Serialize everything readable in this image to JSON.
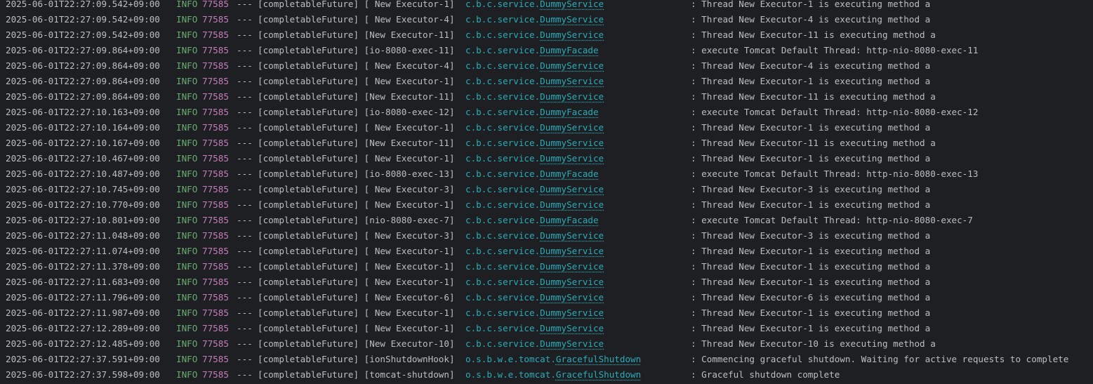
{
  "colors": {
    "background": "#1e1f22",
    "text": "#bcbec4",
    "level": "#6aab73",
    "pid": "#c77dbb",
    "logger": "#2aacb8"
  },
  "log_lines": [
    {
      "timestamp": "2025-06-01T22:27:09.542+09:00",
      "level": "INFO",
      "pid": "77585",
      "sep": "---",
      "app": "[completableFuture]",
      "thread": "[ New Executor-1]",
      "logger_pkg": "c.b.c.service.",
      "logger_cls": "DummyService",
      "message": ": Thread New Executor-1 is executing method a"
    },
    {
      "timestamp": "2025-06-01T22:27:09.542+09:00",
      "level": "INFO",
      "pid": "77585",
      "sep": "---",
      "app": "[completableFuture]",
      "thread": "[ New Executor-4]",
      "logger_pkg": "c.b.c.service.",
      "logger_cls": "DummyService",
      "message": ": Thread New Executor-4 is executing method a"
    },
    {
      "timestamp": "2025-06-01T22:27:09.542+09:00",
      "level": "INFO",
      "pid": "77585",
      "sep": "---",
      "app": "[completableFuture]",
      "thread": "[New Executor-11]",
      "logger_pkg": "c.b.c.service.",
      "logger_cls": "DummyService",
      "message": ": Thread New Executor-11 is executing method a"
    },
    {
      "timestamp": "2025-06-01T22:27:09.864+09:00",
      "level": "INFO",
      "pid": "77585",
      "sep": "---",
      "app": "[completableFuture]",
      "thread": "[io-8080-exec-11]",
      "logger_pkg": "c.b.c.service.",
      "logger_cls": "DummyFacade",
      "message": ": execute Tomcat Default Thread: http-nio-8080-exec-11"
    },
    {
      "timestamp": "2025-06-01T22:27:09.864+09:00",
      "level": "INFO",
      "pid": "77585",
      "sep": "---",
      "app": "[completableFuture]",
      "thread": "[ New Executor-4]",
      "logger_pkg": "c.b.c.service.",
      "logger_cls": "DummyService",
      "message": ": Thread New Executor-4 is executing method a"
    },
    {
      "timestamp": "2025-06-01T22:27:09.864+09:00",
      "level": "INFO",
      "pid": "77585",
      "sep": "---",
      "app": "[completableFuture]",
      "thread": "[ New Executor-1]",
      "logger_pkg": "c.b.c.service.",
      "logger_cls": "DummyService",
      "message": ": Thread New Executor-1 is executing method a"
    },
    {
      "timestamp": "2025-06-01T22:27:09.864+09:00",
      "level": "INFO",
      "pid": "77585",
      "sep": "---",
      "app": "[completableFuture]",
      "thread": "[New Executor-11]",
      "logger_pkg": "c.b.c.service.",
      "logger_cls": "DummyService",
      "message": ": Thread New Executor-11 is executing method a"
    },
    {
      "timestamp": "2025-06-01T22:27:10.163+09:00",
      "level": "INFO",
      "pid": "77585",
      "sep": "---",
      "app": "[completableFuture]",
      "thread": "[io-8080-exec-12]",
      "logger_pkg": "c.b.c.service.",
      "logger_cls": "DummyFacade",
      "message": ": execute Tomcat Default Thread: http-nio-8080-exec-12"
    },
    {
      "timestamp": "2025-06-01T22:27:10.164+09:00",
      "level": "INFO",
      "pid": "77585",
      "sep": "---",
      "app": "[completableFuture]",
      "thread": "[ New Executor-1]",
      "logger_pkg": "c.b.c.service.",
      "logger_cls": "DummyService",
      "message": ": Thread New Executor-1 is executing method a"
    },
    {
      "timestamp": "2025-06-01T22:27:10.167+09:00",
      "level": "INFO",
      "pid": "77585",
      "sep": "---",
      "app": "[completableFuture]",
      "thread": "[New Executor-11]",
      "logger_pkg": "c.b.c.service.",
      "logger_cls": "DummyService",
      "message": ": Thread New Executor-11 is executing method a"
    },
    {
      "timestamp": "2025-06-01T22:27:10.467+09:00",
      "level": "INFO",
      "pid": "77585",
      "sep": "---",
      "app": "[completableFuture]",
      "thread": "[ New Executor-1]",
      "logger_pkg": "c.b.c.service.",
      "logger_cls": "DummyService",
      "message": ": Thread New Executor-1 is executing method a"
    },
    {
      "timestamp": "2025-06-01T22:27:10.487+09:00",
      "level": "INFO",
      "pid": "77585",
      "sep": "---",
      "app": "[completableFuture]",
      "thread": "[io-8080-exec-13]",
      "logger_pkg": "c.b.c.service.",
      "logger_cls": "DummyFacade",
      "message": ": execute Tomcat Default Thread: http-nio-8080-exec-13"
    },
    {
      "timestamp": "2025-06-01T22:27:10.745+09:00",
      "level": "INFO",
      "pid": "77585",
      "sep": "---",
      "app": "[completableFuture]",
      "thread": "[ New Executor-3]",
      "logger_pkg": "c.b.c.service.",
      "logger_cls": "DummyService",
      "message": ": Thread New Executor-3 is executing method a"
    },
    {
      "timestamp": "2025-06-01T22:27:10.770+09:00",
      "level": "INFO",
      "pid": "77585",
      "sep": "---",
      "app": "[completableFuture]",
      "thread": "[ New Executor-1]",
      "logger_pkg": "c.b.c.service.",
      "logger_cls": "DummyService",
      "message": ": Thread New Executor-1 is executing method a"
    },
    {
      "timestamp": "2025-06-01T22:27:10.801+09:00",
      "level": "INFO",
      "pid": "77585",
      "sep": "---",
      "app": "[completableFuture]",
      "thread": "[nio-8080-exec-7]",
      "logger_pkg": "c.b.c.service.",
      "logger_cls": "DummyFacade",
      "message": ": execute Tomcat Default Thread: http-nio-8080-exec-7"
    },
    {
      "timestamp": "2025-06-01T22:27:11.048+09:00",
      "level": "INFO",
      "pid": "77585",
      "sep": "---",
      "app": "[completableFuture]",
      "thread": "[ New Executor-3]",
      "logger_pkg": "c.b.c.service.",
      "logger_cls": "DummyService",
      "message": ": Thread New Executor-3 is executing method a"
    },
    {
      "timestamp": "2025-06-01T22:27:11.074+09:00",
      "level": "INFO",
      "pid": "77585",
      "sep": "---",
      "app": "[completableFuture]",
      "thread": "[ New Executor-1]",
      "logger_pkg": "c.b.c.service.",
      "logger_cls": "DummyService",
      "message": ": Thread New Executor-1 is executing method a"
    },
    {
      "timestamp": "2025-06-01T22:27:11.378+09:00",
      "level": "INFO",
      "pid": "77585",
      "sep": "---",
      "app": "[completableFuture]",
      "thread": "[ New Executor-1]",
      "logger_pkg": "c.b.c.service.",
      "logger_cls": "DummyService",
      "message": ": Thread New Executor-1 is executing method a"
    },
    {
      "timestamp": "2025-06-01T22:27:11.683+09:00",
      "level": "INFO",
      "pid": "77585",
      "sep": "---",
      "app": "[completableFuture]",
      "thread": "[ New Executor-1]",
      "logger_pkg": "c.b.c.service.",
      "logger_cls": "DummyService",
      "message": ": Thread New Executor-1 is executing method a"
    },
    {
      "timestamp": "2025-06-01T22:27:11.796+09:00",
      "level": "INFO",
      "pid": "77585",
      "sep": "---",
      "app": "[completableFuture]",
      "thread": "[ New Executor-6]",
      "logger_pkg": "c.b.c.service.",
      "logger_cls": "DummyService",
      "message": ": Thread New Executor-6 is executing method a"
    },
    {
      "timestamp": "2025-06-01T22:27:11.987+09:00",
      "level": "INFO",
      "pid": "77585",
      "sep": "---",
      "app": "[completableFuture]",
      "thread": "[ New Executor-1]",
      "logger_pkg": "c.b.c.service.",
      "logger_cls": "DummyService",
      "message": ": Thread New Executor-1 is executing method a"
    },
    {
      "timestamp": "2025-06-01T22:27:12.289+09:00",
      "level": "INFO",
      "pid": "77585",
      "sep": "---",
      "app": "[completableFuture]",
      "thread": "[ New Executor-1]",
      "logger_pkg": "c.b.c.service.",
      "logger_cls": "DummyService",
      "message": ": Thread New Executor-1 is executing method a"
    },
    {
      "timestamp": "2025-06-01T22:27:12.485+09:00",
      "level": "INFO",
      "pid": "77585",
      "sep": "---",
      "app": "[completableFuture]",
      "thread": "[New Executor-10]",
      "logger_pkg": "c.b.c.service.",
      "logger_cls": "DummyService",
      "message": ": Thread New Executor-10 is executing method a"
    },
    {
      "timestamp": "2025-06-01T22:27:37.591+09:00",
      "level": "INFO",
      "pid": "77585",
      "sep": "---",
      "app": "[completableFuture]",
      "thread": "[ionShutdownHook]",
      "logger_pkg": "o.s.b.w.e.tomcat.",
      "logger_cls": "GracefulShutdown",
      "message": ": Commencing graceful shutdown. Waiting for active requests to complete"
    },
    {
      "timestamp": "2025-06-01T22:27:37.598+09:00",
      "level": "INFO",
      "pid": "77585",
      "sep": "---",
      "app": "[completableFuture]",
      "thread": "[tomcat-shutdown]",
      "logger_pkg": "o.s.b.w.e.tomcat.",
      "logger_cls": "GracefulShutdown",
      "message": ": Graceful shutdown complete"
    }
  ]
}
